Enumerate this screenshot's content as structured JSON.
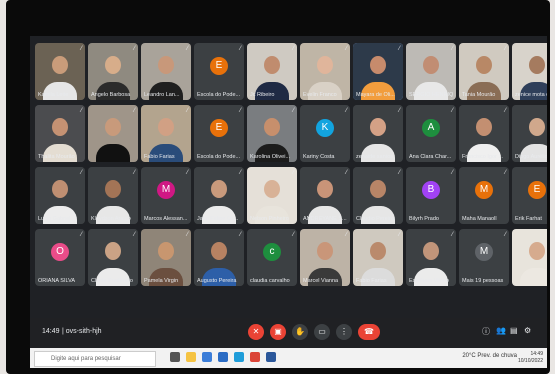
{
  "meeting": {
    "time": "14:49",
    "code": "ovs-sith-hjh",
    "accent_color": "#8ab4f8",
    "end_call_color": "#ea4335"
  },
  "participants": [
    {
      "name": "Kamila Leite",
      "type": "photo",
      "skin": "#c99c7a",
      "shirt": "#e6e6e6",
      "bg": "#6b6254"
    },
    {
      "name": "Angelo Barbosa",
      "type": "photo",
      "skin": "#d7ad8a",
      "shirt": "#2b2b2b",
      "bg": "#8f8a80"
    },
    {
      "name": "Leandro Lan...",
      "type": "photo",
      "skin": "#c8987a",
      "shirt": "#1f1f1f",
      "bg": "#a9a39a"
    },
    {
      "name": "Escola do Pode...",
      "type": "avatar",
      "initial": "E",
      "color": "#e8710a"
    },
    {
      "name": "Jc Ribeiro",
      "type": "photo",
      "skin": "#c08c6e",
      "shirt": "#1f2a44",
      "bg": "#cfcac2"
    },
    {
      "name": "Evelin Franco",
      "type": "photo",
      "skin": "#e0b59b",
      "shirt": "#d9d1c6",
      "bg": "#bfb5a6"
    },
    {
      "name": "Mayara de Oli...",
      "type": "photo",
      "skin": "#c78b6c",
      "shirt": "#f29d3d",
      "bg": "#2d3a4a",
      "active": true
    },
    {
      "name": "SERGIO HENRIQ...",
      "type": "photo",
      "skin": "#c18d73",
      "shirt": "#e8e8e8",
      "bg": "#bdbab5"
    },
    {
      "name": "Tania Mourão",
      "type": "photo",
      "skin": "#b88866",
      "shirt": "#8a6d55",
      "bg": "#d0cac0"
    },
    {
      "name": "zenice mota c...",
      "type": "photo",
      "skin": "#a57b5f",
      "shirt": "#2f3f5a",
      "bg": "#d8d3cb"
    },
    {
      "name": "Thalita Mourão",
      "type": "photo",
      "skin": "#c59273",
      "shirt": "#e4ddd2",
      "bg": "#4b4c4f"
    },
    {
      "name": "",
      "type": "photo",
      "skin": "#c89a7b",
      "shirt": "#111111",
      "bg": "#9f9589"
    },
    {
      "name": "Fabio Farias",
      "type": "photo",
      "skin": "#d1a084",
      "shirt": "#2a4c7a",
      "bg": "#b3a48e"
    },
    {
      "name": "Escola do Pode...",
      "type": "avatar",
      "initial": "E",
      "color": "#e8710a"
    },
    {
      "name": "Karolina Olivei...",
      "type": "photo",
      "skin": "#c78f6c",
      "shirt": "#1c1c1c",
      "bg": "#7a7d80"
    },
    {
      "name": "Kariny Costa",
      "type": "avatar",
      "initial": "K",
      "color": "#12a4df"
    },
    {
      "name": "zenaide santos",
      "type": "photo",
      "skin": "#d4a186",
      "shirt": "#e6e6e6",
      "bg": "#3c4043"
    },
    {
      "name": "Ana Clara Char...",
      "type": "avatar",
      "initial": "A",
      "color": "#1e8e3e"
    },
    {
      "name": "Francisco Igor ...",
      "type": "photo",
      "skin": "#c38f71",
      "shirt": "#efefef",
      "bg": "#3c4043"
    },
    {
      "name": "Diogo Aurélio",
      "type": "photo",
      "skin": "#d0a88c",
      "shirt": "#e3e3e3",
      "bg": "#3c4043"
    },
    {
      "name": "Lucia Gabriel",
      "type": "photo",
      "skin": "#bf8f72",
      "shirt": "#ececec",
      "bg": "#3c4043"
    },
    {
      "name": "Kleydson Araujo",
      "type": "photo",
      "skin": "#a37456",
      "shirt": "#e7e7e7",
      "bg": "#3c4043"
    },
    {
      "name": "Marcos Alessan...",
      "type": "avatar",
      "initial": "M",
      "color": "#d01884"
    },
    {
      "name": "Jairo Felipe Oli...",
      "type": "photo",
      "skin": "#c99a7c",
      "shirt": "#ebebeb",
      "bg": "#3c4043"
    },
    {
      "name": "Nelson Pinheiro",
      "type": "photo",
      "skin": "#d8b297",
      "shirt": "#e8e4dc",
      "bg": "#e5e0d8"
    },
    {
      "name": "ANDREYANE S...",
      "type": "photo",
      "skin": "#c99478",
      "shirt": "#e6e6e6",
      "bg": "#3c4043"
    },
    {
      "name": "Cláudio Pereira",
      "type": "photo",
      "skin": "#b88567",
      "shirt": "#e6e6e6",
      "bg": "#3c4043"
    },
    {
      "name": "Bilyrh Prado",
      "type": "avatar",
      "initial": "B",
      "color": "#a142f4"
    },
    {
      "name": "Maha Manaoll",
      "type": "avatar",
      "initial": "M",
      "color": "#e8710a"
    },
    {
      "name": "Erik Farhat",
      "type": "avatar",
      "initial": "E",
      "color": "#e8710a"
    },
    {
      "name": "ORIANA SILVA",
      "type": "avatar",
      "initial": "O",
      "color": "#ea4c89"
    },
    {
      "name": "Cleide Prudêncio",
      "type": "photo",
      "skin": "#caa285",
      "shirt": "#ebebeb",
      "bg": "#3c4043"
    },
    {
      "name": "Pamela Virgin",
      "type": "photo",
      "skin": "#c8966f",
      "shirt": "#6b4f3f",
      "bg": "#8f8578"
    },
    {
      "name": "Augusto Pereira",
      "type": "photo",
      "skin": "#b78262",
      "shirt": "#2d5fa8",
      "bg": "#3c4043"
    },
    {
      "name": "claudia carvalho",
      "type": "avatar",
      "initial": "c",
      "color": "#1e8e3e"
    },
    {
      "name": "Marcel Vianna",
      "type": "photo",
      "skin": "#c99679",
      "shirt": "#3a3a3a",
      "bg": "#bdb3a6"
    },
    {
      "name": "Fabio Farias",
      "type": "photo",
      "skin": "#ba8a6c",
      "shirt": "#dcdcdc",
      "bg": "#cfc9bf"
    },
    {
      "name": "Estefânia Vitório",
      "type": "photo",
      "skin": "#c1957a",
      "shirt": "#ebebeb",
      "bg": "#3c4043"
    },
    {
      "name": "Mais 19 pessoas",
      "type": "more",
      "initial": "M",
      "color": "#5f6368"
    },
    {
      "name": "",
      "type": "photo",
      "skin": "#d6ab8e",
      "shirt": "#ece8e1",
      "bg": "#e8e4dc"
    }
  ],
  "controls": [
    {
      "name": "mic-off-button",
      "glyph": "✕",
      "red": true
    },
    {
      "name": "camera-off-button",
      "glyph": "▣",
      "red": true
    },
    {
      "name": "raise-hand-button",
      "glyph": "✋",
      "red": false
    },
    {
      "name": "present-button",
      "glyph": "▭",
      "red": false
    },
    {
      "name": "more-options-button",
      "glyph": "⋮",
      "red": false
    },
    {
      "name": "end-call-button",
      "glyph": "☎",
      "red": true,
      "end": true
    }
  ],
  "right_controls": [
    {
      "name": "info-icon",
      "glyph": "ⓘ"
    },
    {
      "name": "people-icon",
      "glyph": "👥"
    },
    {
      "name": "chat-icon",
      "glyph": "▤"
    },
    {
      "name": "activities-icon",
      "glyph": "⚙"
    }
  ],
  "taskbar": {
    "search_placeholder": "Digite aqui para pesquisar",
    "weather": "20°C Prev. de chuva",
    "time": "14:49",
    "date": "10/10/2022",
    "icons": [
      {
        "name": "task-view-icon",
        "color": "#555"
      },
      {
        "name": "explorer-icon",
        "color": "#f5c342"
      },
      {
        "name": "store-icon",
        "color": "#3b7dd8"
      },
      {
        "name": "mail-icon",
        "color": "#2b6cc4"
      },
      {
        "name": "edge-icon",
        "color": "#1f9dd9"
      },
      {
        "name": "chrome-icon",
        "color": "#db4437"
      },
      {
        "name": "word-icon",
        "color": "#2b579a"
      }
    ]
  }
}
